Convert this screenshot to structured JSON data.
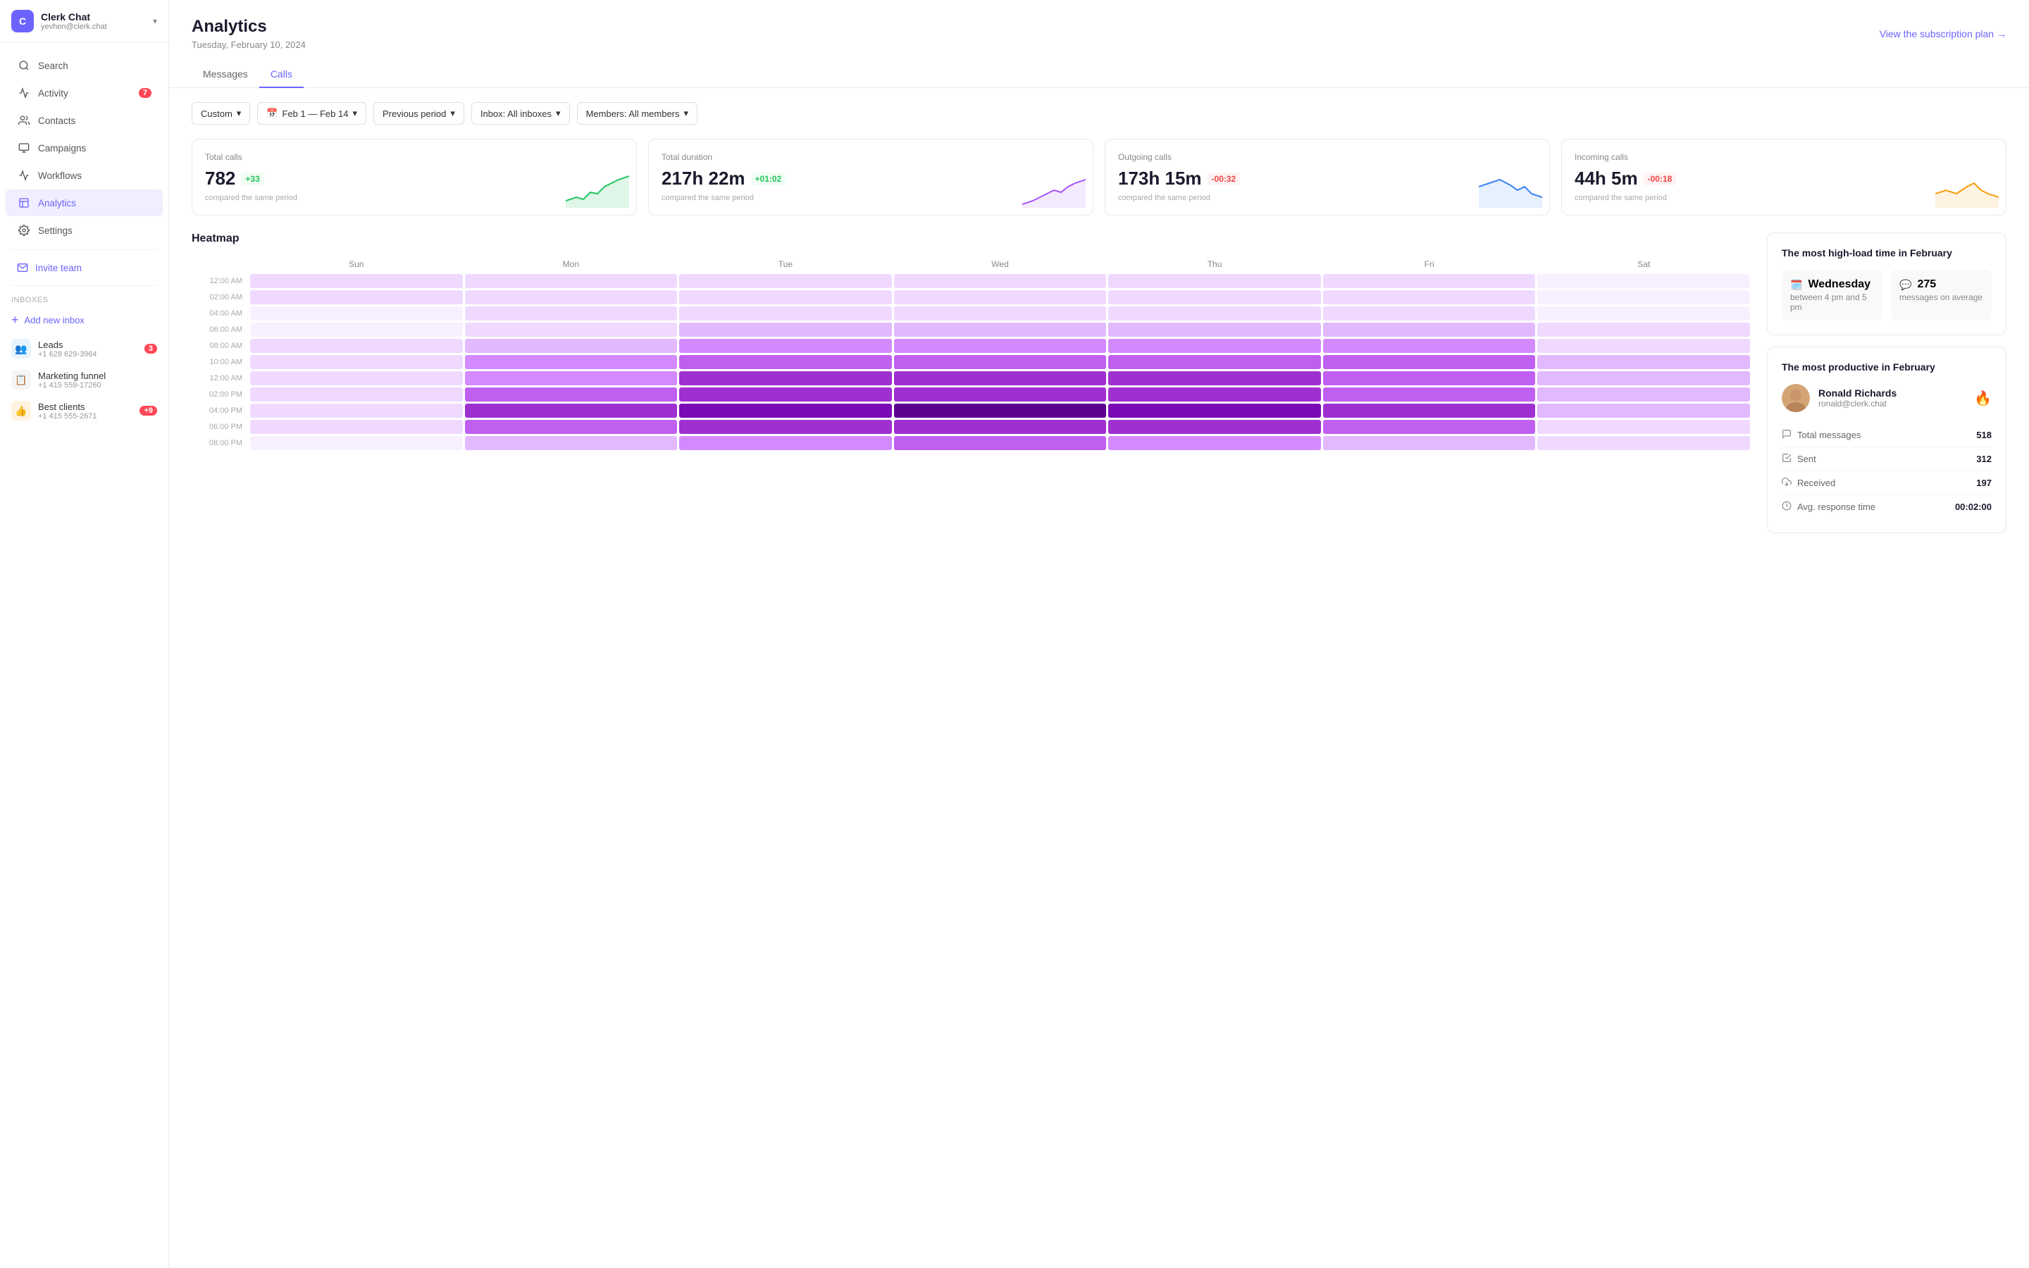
{
  "sidebar": {
    "brand": {
      "name": "Clerk Chat",
      "email": "yevhen@clerk.chat",
      "logo_letter": "C"
    },
    "nav_items": [
      {
        "id": "search",
        "label": "Search",
        "icon": "search",
        "badge": null
      },
      {
        "id": "activity",
        "label": "Activity",
        "icon": "activity",
        "badge": "7"
      },
      {
        "id": "contacts",
        "label": "Contacts",
        "icon": "contacts",
        "badge": null
      },
      {
        "id": "campaigns",
        "label": "Campaigns",
        "icon": "campaigns",
        "badge": null
      },
      {
        "id": "workflows",
        "label": "Workflows",
        "icon": "workflows",
        "badge": null
      },
      {
        "id": "analytics",
        "label": "Analytics",
        "icon": "analytics",
        "badge": null,
        "active": true
      },
      {
        "id": "settings",
        "label": "Settings",
        "icon": "settings",
        "badge": null
      }
    ],
    "invite_team": "Invite team",
    "inboxes_label": "Inboxes",
    "add_inbox": "Add new inbox",
    "inboxes": [
      {
        "id": "leads",
        "name": "Leads",
        "phone": "+1 628 629-3964",
        "badge": "3",
        "icon": "👥"
      },
      {
        "id": "marketing",
        "name": "Marketing funnel",
        "phone": "+1 415 559-17260",
        "badge": null,
        "icon": "📋"
      },
      {
        "id": "bestclients",
        "name": "Best clients",
        "phone": "+1 415 555-2671",
        "badge": "+9",
        "icon": "👍"
      }
    ]
  },
  "header": {
    "title": "Analytics",
    "date": "Tuesday, February 10, 2024",
    "view_plan": "View the subscription plan →"
  },
  "tabs": [
    {
      "id": "messages",
      "label": "Messages",
      "active": false
    },
    {
      "id": "calls",
      "label": "Calls",
      "active": true
    }
  ],
  "filters": {
    "period_type": "Custom",
    "date_range": "Feb 1 — Feb 14",
    "comparison": "Previous period",
    "inbox": "Inbox: All inboxes",
    "members": "Members: All members"
  },
  "stats": [
    {
      "id": "total-calls",
      "label": "Total calls",
      "value": "782",
      "change": "+33",
      "change_type": "up",
      "description": "compared the same period",
      "chart_color": "#22c55e"
    },
    {
      "id": "total-duration",
      "label": "Total duration",
      "value": "217h 22m",
      "change": "+01:02",
      "change_type": "up",
      "description": "compared the same period",
      "chart_color": "#a855f7"
    },
    {
      "id": "outgoing-calls",
      "label": "Outgoing calls",
      "value": "173h 15m",
      "change": "-00:32",
      "change_type": "down",
      "description": "compared the same period",
      "chart_color": "#3b82f6"
    },
    {
      "id": "incoming-calls",
      "label": "Incoming calls",
      "value": "44h 5m",
      "change": "-00:18",
      "change_type": "down",
      "description": "compared the same period",
      "chart_color": "#f59e0b"
    }
  ],
  "heatmap": {
    "title": "Heatmap",
    "days": [
      "Sun",
      "Mon",
      "Tue",
      "Wed",
      "Thu",
      "Fri",
      "Sat"
    ],
    "times": [
      "12:00 AM",
      "02:00 AM",
      "04:00 AM",
      "06:00 AM",
      "08:00 AM",
      "10:00 AM",
      "12:00 AM",
      "02:00 PM",
      "04:00 PM",
      "06:00 PM",
      "08:00 PM"
    ],
    "intensity": [
      [
        1,
        1,
        1,
        1,
        1,
        1,
        0
      ],
      [
        1,
        1,
        1,
        1,
        1,
        1,
        0
      ],
      [
        0,
        1,
        1,
        1,
        1,
        1,
        0
      ],
      [
        0,
        1,
        2,
        2,
        2,
        2,
        1
      ],
      [
        1,
        2,
        3,
        3,
        3,
        3,
        1
      ],
      [
        1,
        3,
        4,
        4,
        4,
        4,
        2
      ],
      [
        1,
        3,
        5,
        5,
        5,
        4,
        2
      ],
      [
        1,
        4,
        5,
        5,
        5,
        4,
        2
      ],
      [
        1,
        5,
        6,
        7,
        6,
        5,
        2
      ],
      [
        1,
        4,
        5,
        5,
        5,
        4,
        1
      ],
      [
        0,
        2,
        3,
        4,
        3,
        2,
        1
      ]
    ]
  },
  "insight": {
    "title": "The most high-load time in February",
    "day": "Wednesday",
    "time_range": "between 4 pm and 5 pm",
    "count": "275",
    "count_label": "messages on average"
  },
  "productive": {
    "title": "The most productive in February",
    "person": {
      "name": "Ronald Richards",
      "email": "ronald@clerk.chat"
    },
    "stats": [
      {
        "label": "Total messages",
        "value": "518"
      },
      {
        "label": "Sent",
        "value": "312"
      },
      {
        "label": "Received",
        "value": "197"
      },
      {
        "label": "Avg. response time",
        "value": "00:02:00"
      }
    ]
  }
}
